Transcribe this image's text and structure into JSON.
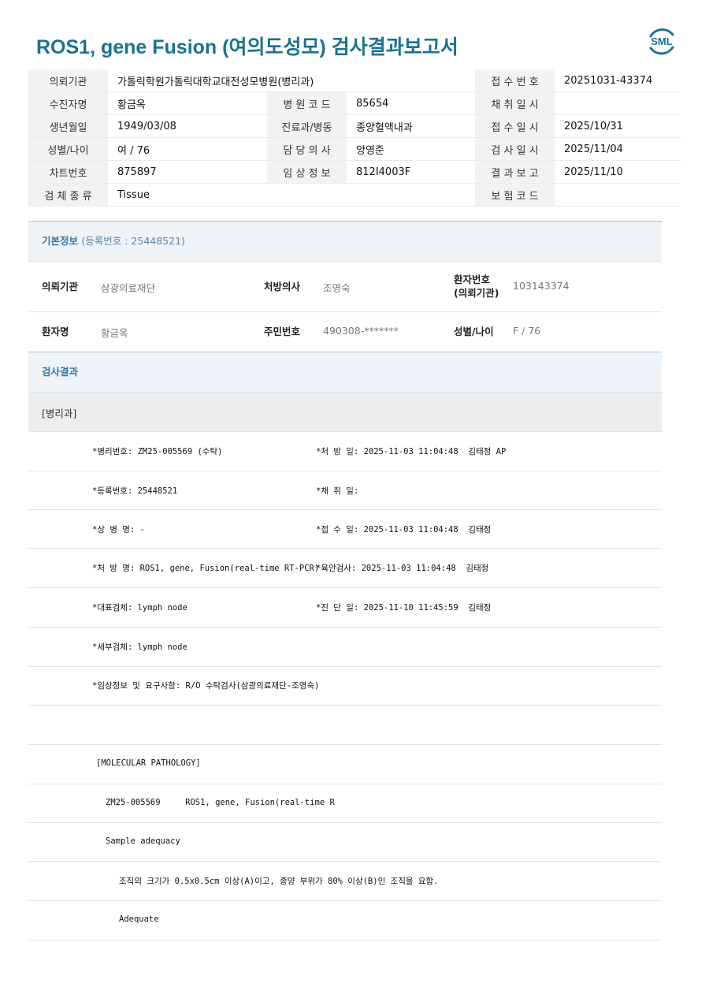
{
  "report": {
    "title": "ROS1, gene Fusion (여의도성모) 검사결과보고서",
    "logo_text": "SML"
  },
  "header_rows": [
    [
      {
        "label": "의뢰기관",
        "value": "가톨릭학원가톨릭대학교대전성모병원(병리과)"
      },
      {
        "label": "",
        "value": ""
      },
      {
        "label": "접 수 번 호",
        "value": "20251031-43374"
      }
    ],
    [
      {
        "label": "수진자명",
        "value": "황금옥"
      },
      {
        "label": "병 원 코 드",
        "value": "85654"
      },
      {
        "label": "채 취 일 시",
        "value": ""
      }
    ],
    [
      {
        "label": "생년월일",
        "value": "1949/03/08"
      },
      {
        "label": "진료과/병동",
        "value": "종양혈액내과"
      },
      {
        "label": "접 수 일 시",
        "value": "2025/10/31"
      }
    ],
    [
      {
        "label": "성별/나이",
        "value": "여 / 76"
      },
      {
        "label": "담 당 의 사",
        "value": "양영준"
      },
      {
        "label": "검 사 일 시",
        "value": "2025/11/04"
      }
    ],
    [
      {
        "label": "차트번호",
        "value": "875897"
      },
      {
        "label": "임 상 정 보",
        "value": "812I4003F"
      },
      {
        "label": "결 과 보 고",
        "value": "2025/11/10"
      }
    ],
    [
      {
        "label": "검 체 종 류",
        "value": "Tissue"
      },
      {
        "label": "",
        "value": ""
      },
      {
        "label": "보 험 코 드",
        "value": ""
      }
    ]
  ],
  "basic_info": {
    "heading": "기본정보",
    "reg_no": "(등록번호 : 25448521)",
    "row1": {
      "k1": "의뢰기관",
      "v1": "삼광의료재단",
      "k2": "처방의사",
      "v2": "조영숙",
      "k3_line1": "환자번호",
      "k3_line2": "(의뢰기관)",
      "v3": "103143374"
    },
    "row2": {
      "k1": "환자명",
      "v1": "황금옥",
      "k2": "주민번호",
      "v2": "490308-*******",
      "k3": "성별/나이",
      "v3": "F / 76"
    }
  },
  "results": {
    "heading": "검사결과",
    "dept": "[병리과]",
    "lines": [
      {
        "left": "*병리번호: ZM25-005569 (수탁)",
        "right": "*처 방 일: 2025-11-03 11:04:48  김태정 AP"
      },
      {
        "left": "*등록번호: 25448521",
        "right": "*채 취 일:"
      },
      {
        "left": "*상 병 명: -",
        "right": "*접 수 일: 2025-11-03 11:04:48  김태정"
      },
      {
        "left": "*처 방 명: ROS1, gene, Fusion(real-time RT-PCR)",
        "right": "*육안검사: 2025-11-03 11:04:48  김태정"
      },
      {
        "left": "*대표검체: lymph node",
        "right": "*진 단 일: 2025-11-10 11:45:59  김태정"
      },
      {
        "left": "*세부검체: lymph node",
        "right": ""
      },
      {
        "left": "*임상정보 및 요구사항: R/O 수탁검사(삼광의료재단-조영숙)",
        "right": ""
      }
    ],
    "molecular_header": "[MOLECULAR PATHOLOGY]",
    "molecular_line": "ZM25-005569     ROS1, gene, Fusion(real-time R",
    "sample_adequacy": "Sample adequacy",
    "adequacy_note": "조직의 크기가 0.5x0.5cm 이상(A)이고, 종양 부위가 80% 이상(B)인 조직을 요함.",
    "adequacy_result": "Adequate"
  },
  "colors": {
    "title": "#1a7391",
    "logo": "#1a7391",
    "section_text": "#3b78a6",
    "section_bg": "#eef3f7"
  }
}
